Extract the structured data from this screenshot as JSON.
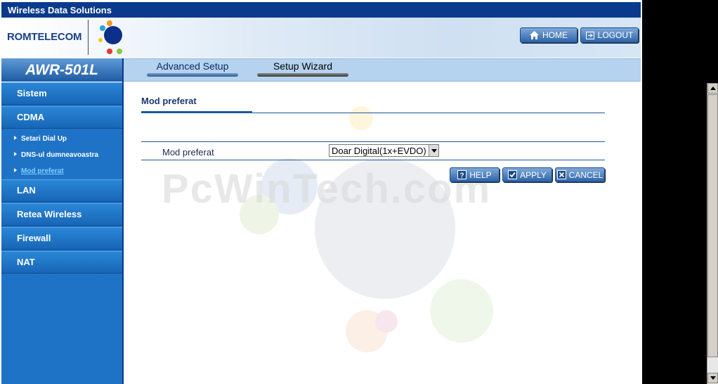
{
  "window": {
    "title": "Wireless Data Solutions"
  },
  "header": {
    "brand": "ROMTELECOM",
    "home_label": "HOME",
    "logout_label": "LOGOUT"
  },
  "model": "AWR-501L",
  "tabs": [
    {
      "label": "Advanced Setup",
      "active": false
    },
    {
      "label": "Setup Wizard",
      "active": true
    }
  ],
  "sidebar": {
    "items": [
      {
        "label": "Sistem"
      },
      {
        "label": "CDMA"
      },
      {
        "label": "LAN"
      },
      {
        "label": "Retea Wireless"
      },
      {
        "label": "Firewall"
      },
      {
        "label": "NAT"
      }
    ],
    "subitems": [
      {
        "label": "Setari Dial Up",
        "active": false
      },
      {
        "label": "DNS-ul dumneavoastra",
        "active": false
      },
      {
        "label": "Mod preferat",
        "active": true
      }
    ]
  },
  "main": {
    "section_title": "Mod preferat",
    "field_label": "Mod preferat",
    "select_value": "Doar Digital(1x+EVDO)",
    "buttons": {
      "help": "HELP",
      "apply": "APPLY",
      "cancel": "CANCEL"
    },
    "watermark": "PcWinTech.com"
  }
}
